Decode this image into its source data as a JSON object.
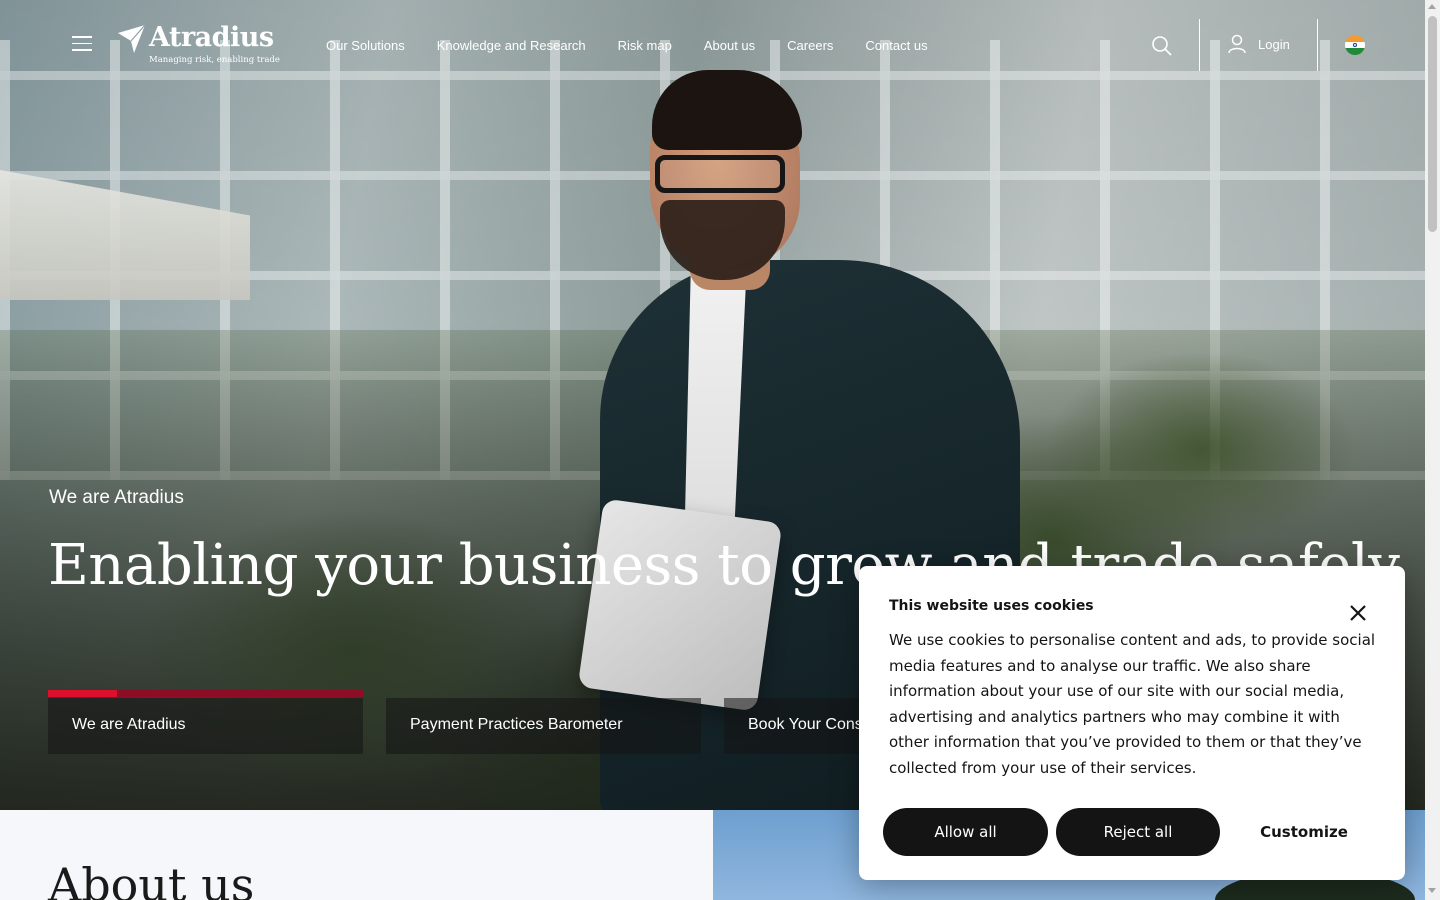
{
  "header": {
    "logo_name": "Atradius",
    "logo_tagline": "Managing risk, enabling trade",
    "nav": [
      "Our Solutions",
      "Knowledge and Research",
      "Risk map",
      "About us",
      "Careers",
      "Contact us"
    ],
    "login_label": "Login",
    "icons": {
      "menu": "hamburger-icon",
      "search": "search-icon",
      "user": "user-icon",
      "flag": "india-flag-icon"
    }
  },
  "hero": {
    "eyebrow": "We are Atradius",
    "title": "Enabling your business to grow and trade safely",
    "tabs": [
      "We are Atradius",
      "Payment Practices Barometer",
      "Book Your Consultation"
    ],
    "active_tab_progress": 0.22,
    "colors": {
      "progress_track": "#8e0d26",
      "progress_fill": "#dc0f2d"
    }
  },
  "cookie": {
    "title": "This website uses cookies",
    "body": "We use cookies to personalise content and ads, to provide social media features and to analyse our traffic. We also share information about your use of our site with our social media, advertising and analytics partners who may combine it with other information that you’ve provided to them or that they’ve collected from your use of their services.",
    "allow_label": "Allow all",
    "reject_label": "Reject all",
    "customize_label": "Customize"
  },
  "about": {
    "title": "About us"
  }
}
